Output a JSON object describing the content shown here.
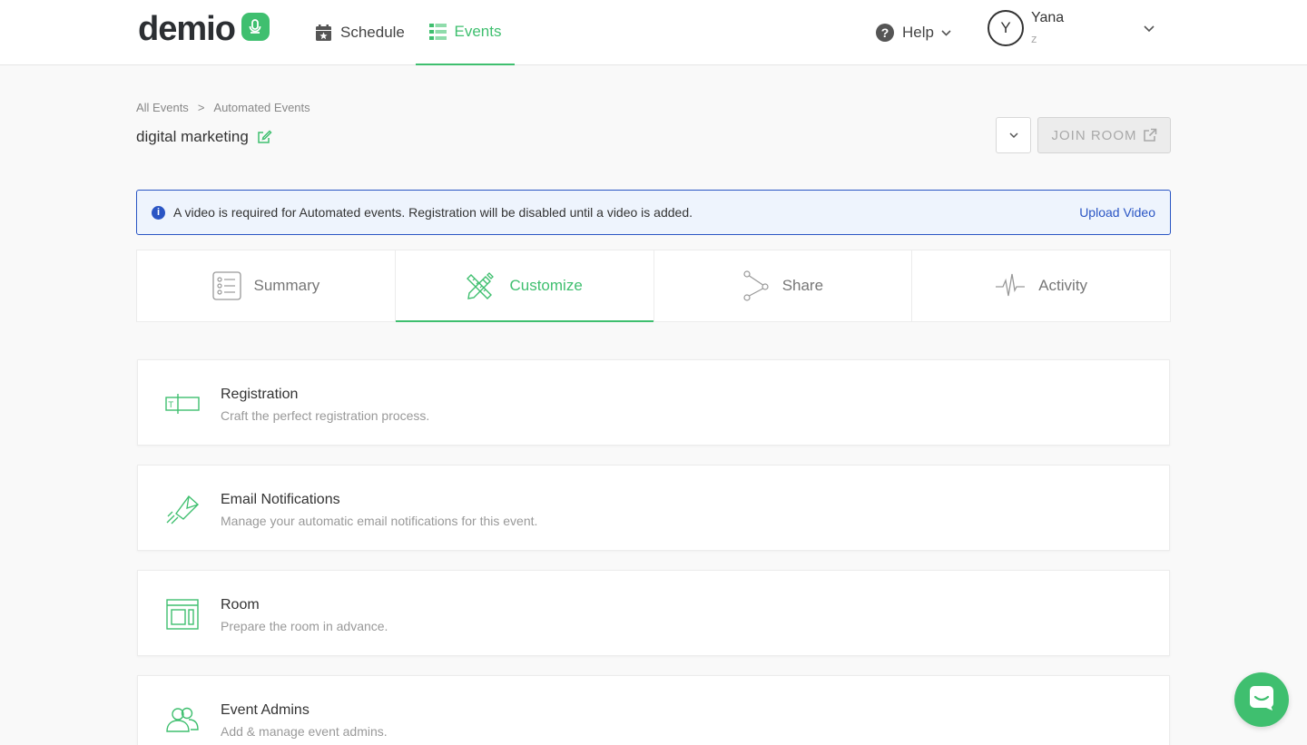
{
  "nav": {
    "logo_text": "demio",
    "schedule_label": "Schedule",
    "events_label": "Events",
    "help_label": "Help"
  },
  "user": {
    "initial": "Y",
    "name": "Yana",
    "sub": "z"
  },
  "breadcrumb": {
    "all_events": "All Events",
    "separator": ">",
    "current": "Automated Events"
  },
  "event": {
    "title": "digital marketing"
  },
  "actions": {
    "join_room_label": "JOIN ROOM"
  },
  "alert": {
    "info_glyph": "i",
    "message": "A video is required for Automated events. Registration will be disabled until a video is added.",
    "link_label": "Upload Video"
  },
  "tabs": [
    {
      "label": "Summary",
      "icon": "checklist-icon",
      "active": false
    },
    {
      "label": "Customize",
      "icon": "pencil-ruler-icon",
      "active": true
    },
    {
      "label": "Share",
      "icon": "share-icon",
      "active": false
    },
    {
      "label": "Activity",
      "icon": "pulse-icon",
      "active": false
    }
  ],
  "cards": [
    {
      "title": "Registration",
      "description": "Craft the perfect registration process.",
      "icon": "form-field-icon"
    },
    {
      "title": "Email Notifications",
      "description": "Manage your automatic email notifications for this event.",
      "icon": "paper-plane-icon"
    },
    {
      "title": "Room",
      "description": "Prepare the room in advance.",
      "icon": "room-layout-icon"
    },
    {
      "title": "Event Admins",
      "description": "Add & manage event admins.",
      "icon": "users-icon"
    }
  ],
  "colors": {
    "brand_green": "#3fbf6f",
    "alert_blue": "#2a55c4",
    "alert_bg": "#eef4fd"
  }
}
